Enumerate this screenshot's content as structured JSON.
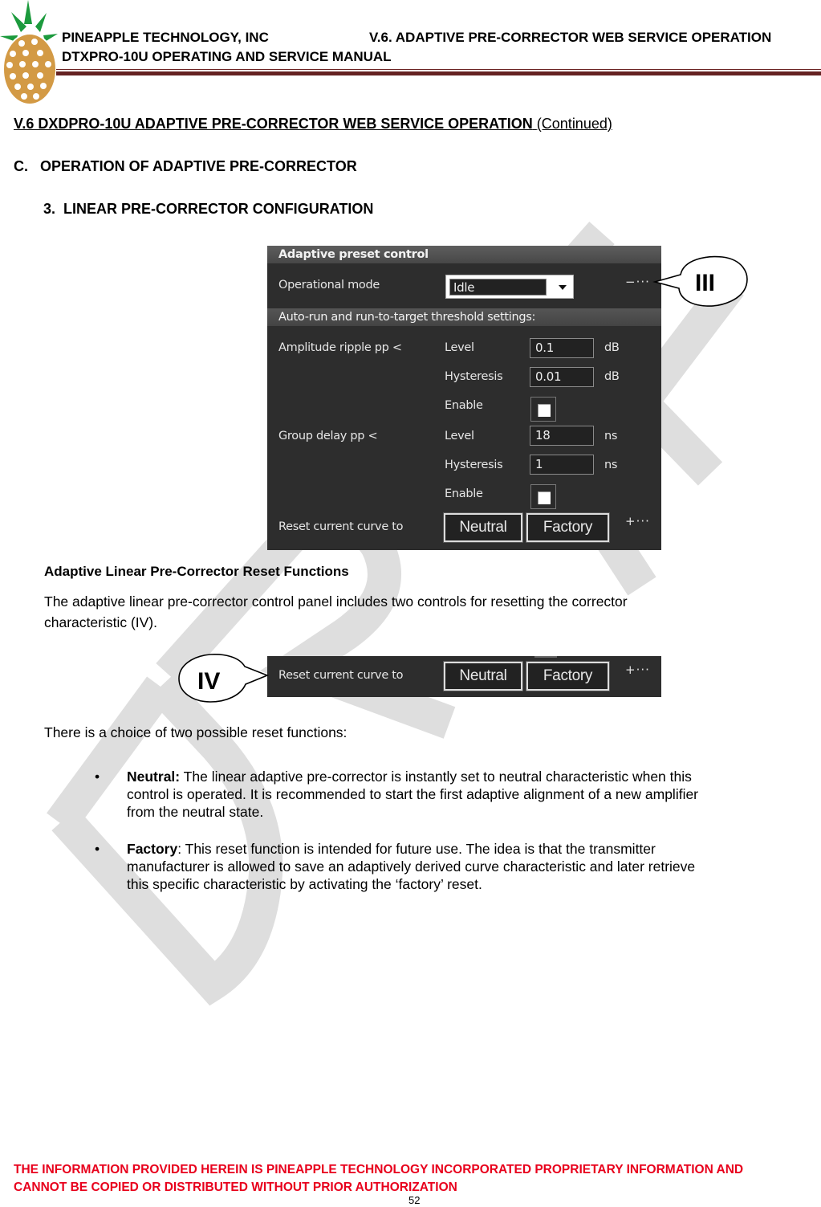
{
  "header": {
    "company": "PINEAPPLE TECHNOLOGY, INC",
    "chapter": "V.6. ADAPTIVE PRE-CORRECTOR WEB SERVICE OPERATION",
    "manual": "DTXPRO-10U OPERATING AND SERVICE MANUAL"
  },
  "section": {
    "title": "V.6  DXDPRO-10U ADAPTIVE PRE-CORRECTOR WEB SERVICE OPERATION",
    "continued": "(Continued)",
    "subsection": "C.   OPERATION OF ADAPTIVE PRE-CORRECTOR",
    "item": "3.  LINEAR PRE-CORRECTOR CONFIGURATION"
  },
  "panel": {
    "title": "Adaptive preset control",
    "operational_mode_label": "Operational mode",
    "operational_mode_value": "Idle",
    "collapse_indicator": "−···",
    "threshold_header": "Auto-run and run-to-target threshold settings:",
    "amplitude": {
      "label": "Amplitude ripple pp <",
      "level_label": "Level",
      "level_value": "0.1",
      "level_unit": "dB",
      "hysteresis_label": "Hysteresis",
      "hysteresis_value": "0.01",
      "hysteresis_unit": "dB",
      "enable_label": "Enable",
      "enabled": false
    },
    "group_delay": {
      "label": "Group delay pp <",
      "level_label": "Level",
      "level_value": "18",
      "level_unit": "ns",
      "hysteresis_label": "Hysteresis",
      "hysteresis_value": "1",
      "hysteresis_unit": "ns",
      "enable_label": "Enable",
      "enabled": false
    },
    "reset_label": "Reset current curve to",
    "neutral_button": "Neutral",
    "factory_button": "Factory",
    "expand_indicator": "+···"
  },
  "callouts": {
    "first": "III",
    "second": "IV"
  },
  "body": {
    "caption": "Adaptive Linear Pre-Corrector Reset Functions",
    "intro_line1": "The adaptive linear pre-corrector control panel includes two controls for resetting the corrector",
    "intro_line2": "characteristic (IV).",
    "choice": "There is a choice of two possible reset functions:",
    "bullets": [
      {
        "term": "Neutral:",
        "lines": [
          " The linear adaptive pre-corrector is instantly set to neutral characteristic when this",
          "control is operated. It is recommended to start the first adaptive alignment of a new amplifier",
          "from the neutral state."
        ]
      },
      {
        "term": "Factory",
        "lines": [
          ": This reset function is intended for future use. The idea is that the transmitter",
          "manufacturer is allowed to save an adaptively derived curve characteristic and later retrieve",
          "this specific characteristic by activating the ‘factory’ reset."
        ]
      }
    ]
  },
  "footer": {
    "line1": "THE INFORMATION PROVIDED HEREIN IS PINEAPPLE TECHNOLOGY INCORPORATED PROPRIETARY INFORMATION AND",
    "line2": "CANNOT BE COPIED OR DISTRIBUTED WITHOUT PRIOR AUTHORIZATION",
    "page_number": "52"
  },
  "watermark": "DRAFT",
  "colors": {
    "header_rule": "#652222",
    "footer_text": "#e8001c",
    "panel_bg": "#2d2d2d",
    "logo_orange": "#d39a45",
    "logo_green": "#1c9a3d"
  }
}
